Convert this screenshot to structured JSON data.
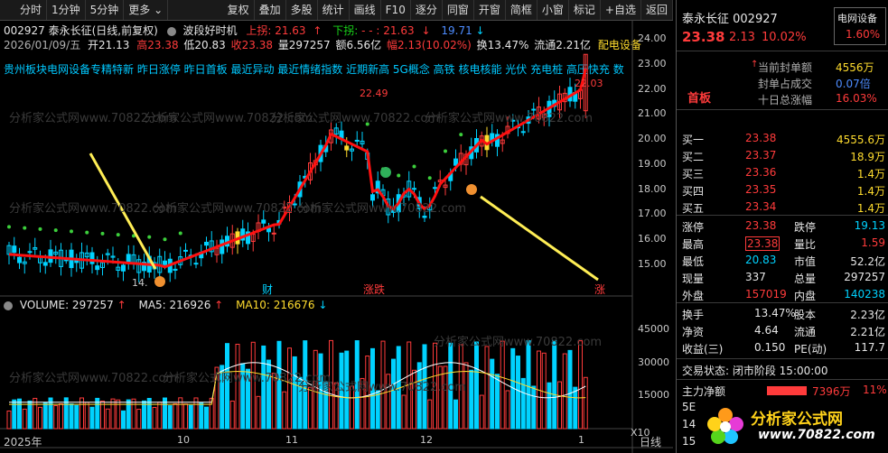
{
  "toolbar": {
    "left": [
      "分时",
      "1分钟",
      "5分钟",
      "更多"
    ],
    "right": [
      "复权",
      "叠加",
      "多股",
      "统计",
      "画线",
      "F10",
      "逐分",
      "同窗",
      "开窗",
      "简框",
      "小窗",
      "标记",
      "+自选",
      "返回"
    ]
  },
  "header": {
    "code_line": "002927  泰永长征(日线,前复权)",
    "indicator_name": "波段好时机",
    "up_label": "上拐:",
    "up_val": "21.63",
    "down_label": "下拐:",
    "down_val": "- - : 21.63",
    "extra_val": "19.71",
    "date": "2026/01/09/五",
    "open": "开21.13",
    "high": "高23.38",
    "low": "低20.83",
    "close": "收23.38",
    "volume": "量297257",
    "amount": "额6.56亿",
    "change": "幅2.13(10.02%)",
    "turnover": "换13.47%",
    "float": "流通2.21亿",
    "sector": "配电设备"
  },
  "concepts": "贵州板块电网设备专精特新  昨日涨停  昨日首板  最近异动  最近情绪指数  近期新高  5G概念  高铁  核电核能  光伏  充电桩  高压快充  数",
  "price_axis": [
    "24.00",
    "23.00",
    "22.00",
    "21.00",
    "20.00",
    "19.00",
    "18.00",
    "17.00",
    "16.00",
    "15.00"
  ],
  "chart_labels": {
    "low_marker": "14.",
    "high_marker": "22.49",
    "right_marker": "22.03",
    "cai": "财",
    "drop": "涨跌",
    "zhang": "涨"
  },
  "volume_header": {
    "title": "VOLUME: 297257",
    "ma5": "MA5: 216926",
    "ma10": "MA10: 216676"
  },
  "volume_axis": [
    "45000",
    "30000",
    "15000",
    "X10"
  ],
  "x_axis": {
    "year": "2025年",
    "months": [
      "10",
      "11",
      "12",
      "1"
    ],
    "mode": "日线"
  },
  "watermark": "分析家公式网www.70822.com",
  "logo": {
    "text": "分析家公式网",
    "url": "www.70822.com"
  },
  "panel": {
    "name": "泰永长征 002927",
    "price": "23.38",
    "chg": "2.13",
    "pct": "10.02%",
    "sector_tag": "电网设备",
    "sector_pct": "1.60%",
    "seal_amount_label": "当前封单额",
    "seal_amount": "4556万",
    "seal_ratio_label": "封单占成交",
    "seal_ratio": "0.07倍",
    "ten_day_label": "十日总涨幅",
    "ten_day": "16.03%",
    "badge": "首板",
    "bids": [
      {
        "label": "买一",
        "price": "23.38",
        "vol": "4555.6万"
      },
      {
        "label": "买二",
        "price": "23.37",
        "vol": "18.9万"
      },
      {
        "label": "买三",
        "price": "23.36",
        "vol": "1.4万"
      },
      {
        "label": "买四",
        "price": "23.35",
        "vol": "1.4万"
      },
      {
        "label": "买五",
        "price": "23.34",
        "vol": "1.4万"
      }
    ],
    "stats": [
      {
        "l1": "涨停",
        "v1": "23.38",
        "l2": "跌停",
        "v2": "19.13"
      },
      {
        "l1": "最高",
        "v1": "23.38",
        "l2": "量比",
        "v2": "1.59"
      },
      {
        "l1": "最低",
        "v1": "20.83",
        "l2": "市值",
        "v2": "52.2亿"
      },
      {
        "l1": "现量",
        "v1": "337",
        "l2": "总量",
        "v2": "297257"
      },
      {
        "l1": "外盘",
        "v1": "157019",
        "l2": "内盘",
        "v2": "140238"
      }
    ],
    "stats2": [
      {
        "l1": "换手",
        "v1": "13.47%",
        "l2": "股本",
        "v2": "2.23亿"
      },
      {
        "l1": "净资",
        "v1": "4.64",
        "l2": "流通",
        "v2": "2.21亿"
      },
      {
        "l1": "收益(三)",
        "v1": "0.150",
        "l2": "PE(动)",
        "v2": "117.7"
      }
    ],
    "trade_status": "交易状态: 闭市阶段 15:00:00",
    "main_net_label": "主力净额",
    "main_net_val": "7396万",
    "main_net_pct": "11%",
    "row_5e": "5E",
    "row_14": "14",
    "row_15": "15"
  },
  "colors": {
    "up": "#ff3b3b",
    "down": "#00d2ff",
    "ma": "#ff1010",
    "yellow": "#ffdc2e"
  }
}
